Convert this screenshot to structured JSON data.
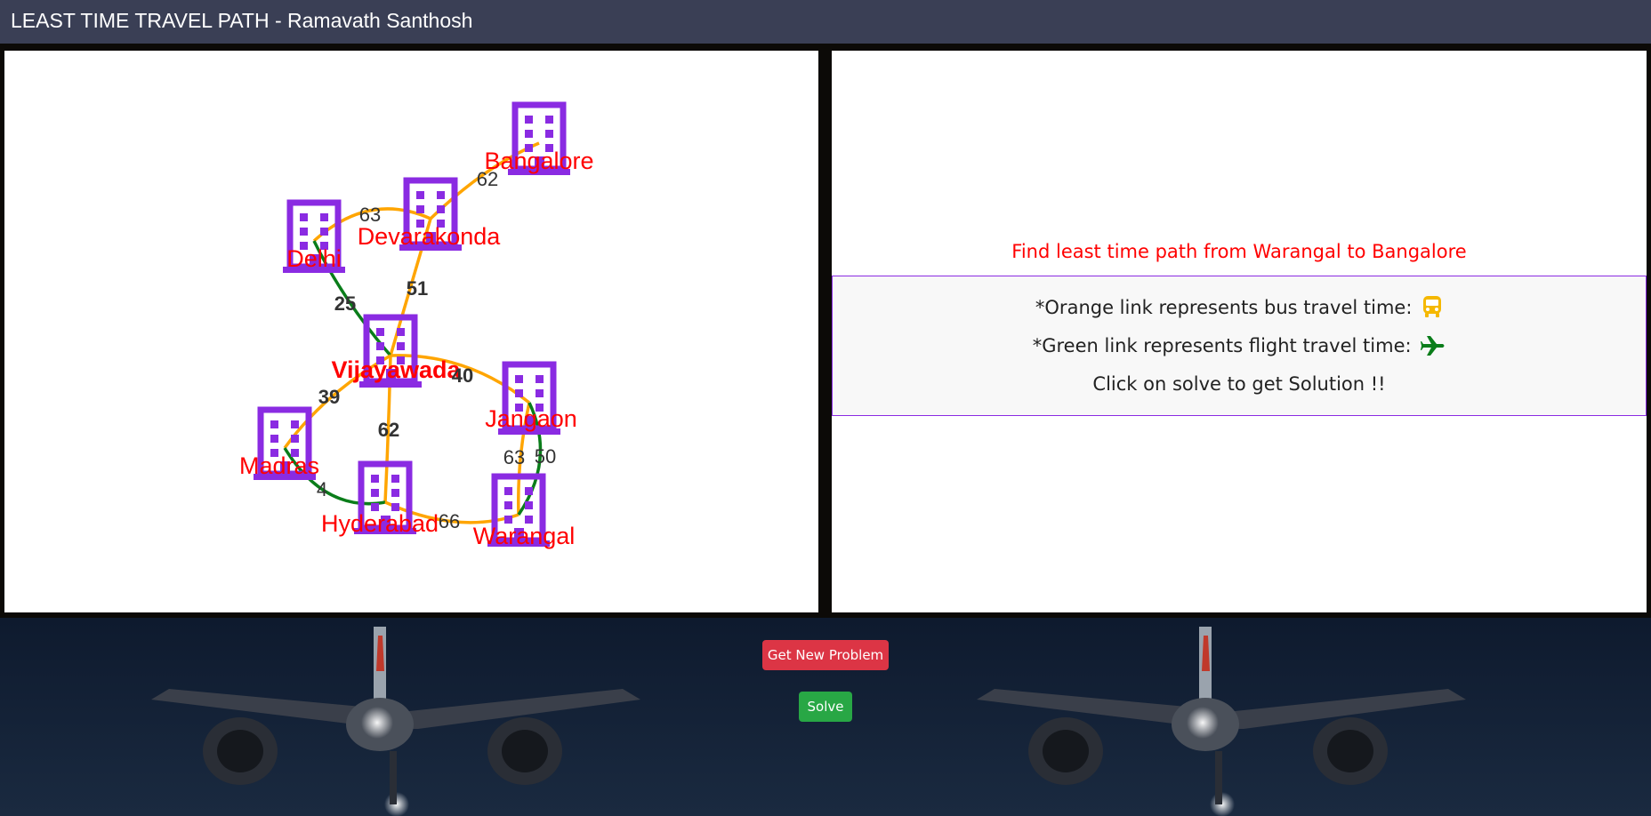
{
  "header": {
    "title": "LEAST TIME TRAVEL PATH - Ramavath Santhosh"
  },
  "graph": {
    "cities": [
      {
        "id": "bangalore",
        "name": "Bangalore",
        "highlight": false
      },
      {
        "id": "devarakonda",
        "name": "Devarakonda",
        "highlight": false
      },
      {
        "id": "delhi",
        "name": "Delhi",
        "highlight": false
      },
      {
        "id": "vijayawada",
        "name": "Vijayawada",
        "highlight": true
      },
      {
        "id": "jangaon",
        "name": "Jangaon",
        "highlight": false
      },
      {
        "id": "madras",
        "name": "Madras",
        "highlight": false
      },
      {
        "id": "hyderabad",
        "name": "Hyderabad",
        "highlight": false
      },
      {
        "id": "warangal",
        "name": "Warangal",
        "highlight": false
      }
    ],
    "edges": [
      {
        "from": "devarakonda",
        "to": "bangalore",
        "mode": "bus",
        "time": "62"
      },
      {
        "from": "delhi",
        "to": "devarakonda",
        "mode": "bus",
        "time": "63"
      },
      {
        "from": "devarakonda",
        "to": "vijayawada",
        "mode": "bus",
        "time": "51"
      },
      {
        "from": "delhi",
        "to": "vijayawada",
        "mode": "flight",
        "time": "25"
      },
      {
        "from": "vijayawada",
        "to": "jangaon",
        "mode": "bus",
        "time": "40"
      },
      {
        "from": "vijayawada",
        "to": "madras",
        "mode": "bus",
        "time": "39"
      },
      {
        "from": "vijayawada",
        "to": "hyderabad",
        "mode": "bus",
        "time": "62"
      },
      {
        "from": "madras",
        "to": "hyderabad",
        "mode": "flight",
        "time": "4"
      },
      {
        "from": "hyderabad",
        "to": "warangal",
        "mode": "bus",
        "time": "66"
      },
      {
        "from": "jangaon",
        "to": "warangal",
        "mode": "bus",
        "time": "63"
      },
      {
        "from": "jangaon",
        "to": "warangal",
        "mode": "flight",
        "time": "50"
      }
    ],
    "colors": {
      "bus": "#ffa500",
      "flight": "#0a7d1a",
      "building": "#8a2be2",
      "city_label": "#ff0000"
    }
  },
  "info": {
    "task": "Find least time path from Warangal to Bangalore",
    "bus_line": "*Orange link represents bus travel time:",
    "flight_line": "*Green link represents flight travel time:",
    "hint": "Click on solve to get Solution !!",
    "bus_icon": "bus-icon",
    "flight_icon": "airplane-icon"
  },
  "buttons": {
    "new_problem": "Get New Problem",
    "solve": "Solve"
  },
  "colors": {
    "header_bg": "#3a3f55",
    "danger": "#dc3545",
    "success": "#28a745",
    "bus_icon": "#f5b800",
    "plane_icon": "#0a7d1a"
  }
}
